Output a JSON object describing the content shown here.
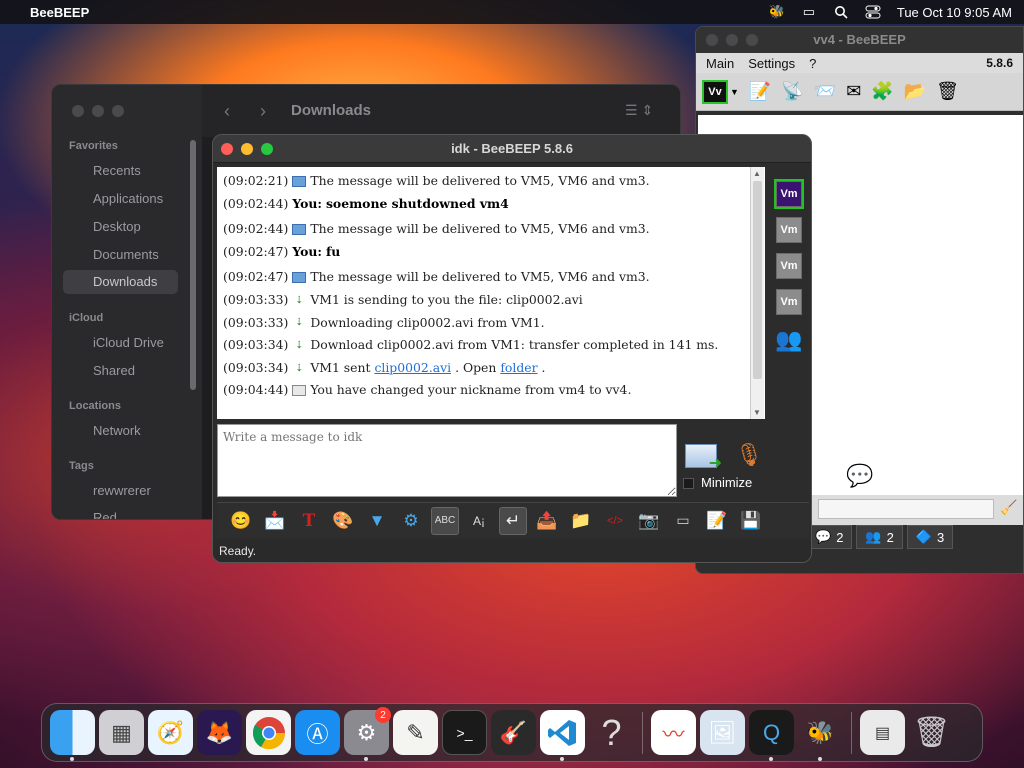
{
  "menubar": {
    "app_name": "BeeBEEP",
    "clock": "Tue Oct 10  9:05 AM"
  },
  "finder": {
    "title": "Downloads",
    "favorites_header": "Favorites",
    "favorites": [
      "Recents",
      "Applications",
      "Desktop",
      "Documents",
      "Downloads"
    ],
    "selected": "Downloads",
    "icloud_header": "iCloud",
    "icloud": [
      "iCloud Drive",
      "Shared"
    ],
    "locations_header": "Locations",
    "locations": [
      "Network"
    ],
    "tags_header": "Tags",
    "tags": [
      "rewwrerer",
      "Red"
    ]
  },
  "vv4": {
    "title": "vv4 - BeeBEEP",
    "menu": [
      "Main",
      "Settings",
      "?"
    ],
    "version": "5.8.6",
    "tabs": [
      {
        "icon": "chat-icon",
        "count": "2"
      },
      {
        "icon": "users-icon",
        "count": "2"
      },
      {
        "icon": "share-icon",
        "count": "3"
      }
    ]
  },
  "chat": {
    "title": "idk - BeeBEEP 5.8.6",
    "messages": [
      {
        "time": "(09:02:21)",
        "icon": "mail-icon",
        "text": "The message will be delivered to VM5, VM6 and vm3."
      },
      {
        "time": "(09:02:44)",
        "speaker": "You:",
        "text": "soemone shutdowned vm4"
      },
      {
        "time": "(09:02:44)",
        "icon": "mail-icon",
        "text": "The message will be delivered to VM5, VM6 and vm3."
      },
      {
        "time": "(09:02:47)",
        "speaker": "You:",
        "text": "fu"
      },
      {
        "time": "(09:02:47)",
        "icon": "mail-icon",
        "text": "The message will be delivered to VM5, VM6 and vm3."
      },
      {
        "time": "(09:03:33)",
        "icon": "download-icon",
        "text": "VM1 is sending to you the file: clip0002.avi"
      },
      {
        "time": "(09:03:33)",
        "icon": "download-icon",
        "text": "Downloading clip0002.avi from VM1."
      },
      {
        "time": "(09:03:34)",
        "icon": "download-icon",
        "text": "Download clip0002.avi from VM1: transfer completed in 141 ms."
      },
      {
        "time": "(09:03:34)",
        "icon": "download-icon",
        "text_a": "VM1 sent",
        "link1": "clip0002.avi",
        "text_b": ". Open",
        "link2": "folder",
        "text_c": "."
      },
      {
        "time": "(09:04:44)",
        "icon": "note-icon",
        "text": "You have changed your nickname from vm4 to vv4."
      }
    ],
    "members": [
      "Vm",
      "Vm",
      "Vm",
      "Vm"
    ],
    "compose_placeholder": "Write a message to idk",
    "minimize_label": "Minimize",
    "status": "Ready."
  },
  "dock": {
    "apps": [
      "finder",
      "launchpad",
      "safari",
      "firefox",
      "chrome",
      "app-store",
      "system-settings",
      "textedit",
      "terminal",
      "garageband",
      "vscode",
      "help",
      "freeform",
      "preview",
      "quicktime",
      "beebeep",
      "screenshot",
      "trash"
    ],
    "settings_badge": "2"
  }
}
